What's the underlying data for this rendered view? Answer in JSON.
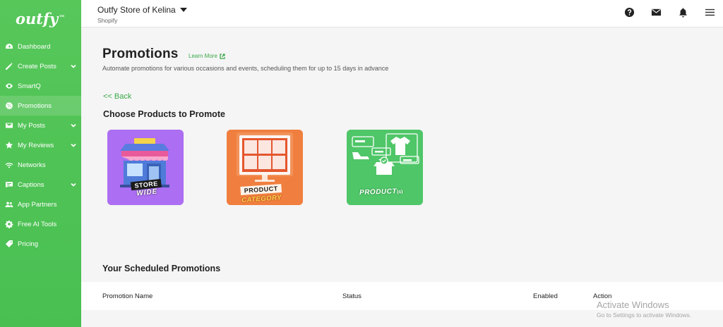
{
  "brand": {
    "logo_text": "outfy",
    "logo_mark": "™"
  },
  "sidebar": {
    "items": [
      {
        "label": "Dashboard",
        "icon": "dashboard-icon",
        "has_chevron": false,
        "active": false
      },
      {
        "label": "Create Posts",
        "icon": "pencil-icon",
        "has_chevron": true,
        "active": false
      },
      {
        "label": "SmartQ",
        "icon": "smartq-icon",
        "has_chevron": false,
        "active": false
      },
      {
        "label": "Promotions",
        "icon": "percent-icon",
        "has_chevron": false,
        "active": true
      },
      {
        "label": "My Posts",
        "icon": "envelope-icon",
        "has_chevron": true,
        "active": false
      },
      {
        "label": "My Reviews",
        "icon": "star-icon",
        "has_chevron": true,
        "active": false
      },
      {
        "label": "Networks",
        "icon": "wifi-icon",
        "has_chevron": false,
        "active": false
      },
      {
        "label": "Captions",
        "icon": "caption-icon",
        "has_chevron": true,
        "active": false
      },
      {
        "label": "App Partners",
        "icon": "users-icon",
        "has_chevron": false,
        "active": false
      },
      {
        "label": "Free AI Tools",
        "icon": "gear-icon",
        "has_chevron": false,
        "active": false
      },
      {
        "label": "Pricing",
        "icon": "tag-icon",
        "has_chevron": false,
        "active": false
      }
    ]
  },
  "topbar": {
    "store_name": "Outfy Store of Kelina",
    "platform": "Shopify",
    "icons": [
      "help-icon",
      "mail-icon",
      "bell-icon",
      "menu-icon"
    ]
  },
  "page": {
    "title": "Promotions",
    "learn_more": "Learn More",
    "description": "Automate promotions for various occasions and events, scheduling them for up to 15 days in advance",
    "back": "<< Back",
    "choose_title": "Choose Products to Promote",
    "options": [
      {
        "line1": "STORE",
        "line2": "WIDE",
        "color": "#ac6ef2"
      },
      {
        "line1": "PRODUCT",
        "line2": "CATEGORY",
        "color": "#f07f3f"
      },
      {
        "line1": "PRODUCT",
        "line2": "(s)",
        "color": "#4fc668"
      }
    ],
    "scheduled_title": "Your Scheduled Promotions",
    "table_headers": {
      "name": "Promotion Name",
      "status": "Status",
      "enabled": "Enabled",
      "action": "Action"
    }
  },
  "watermark": {
    "title": "Activate Windows",
    "subtitle": "Go to Settings to activate Windows."
  },
  "colors": {
    "brand_green": "#4dc257",
    "link_green": "#3aa84a"
  }
}
